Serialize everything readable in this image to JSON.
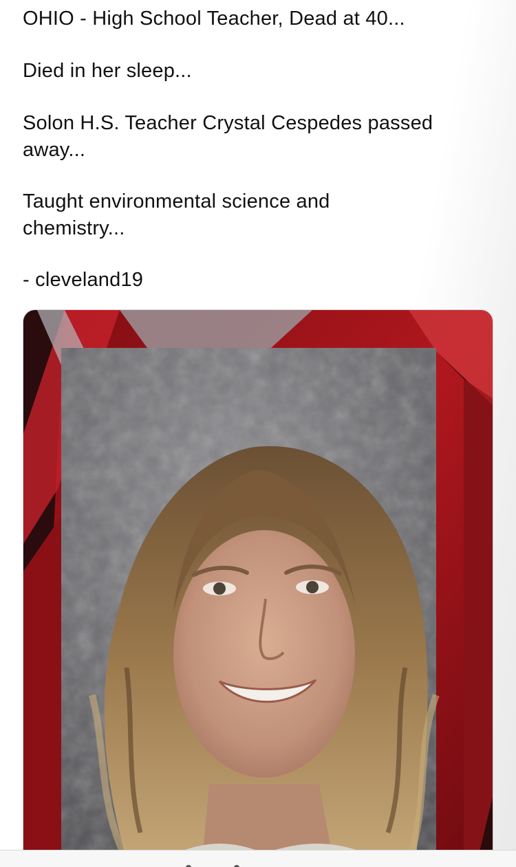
{
  "post": {
    "lines": [
      "OHIO - High School Teacher, Dead at 40...",
      "Died in her sleep...",
      "Solon H.S. Teacher Crystal Cespedes passed",
      "away...",
      "Taught environmental science and",
      "chemistry...",
      "- cleveland19"
    ]
  },
  "media": {
    "icon": "photo-of-person",
    "colors": {
      "frame_red": "#a3151c",
      "frame_dark": "#1a0a0b",
      "backdrop_gray": "#6f6f72",
      "hair": "#8a6a43",
      "skin": "#c79a7c"
    }
  }
}
